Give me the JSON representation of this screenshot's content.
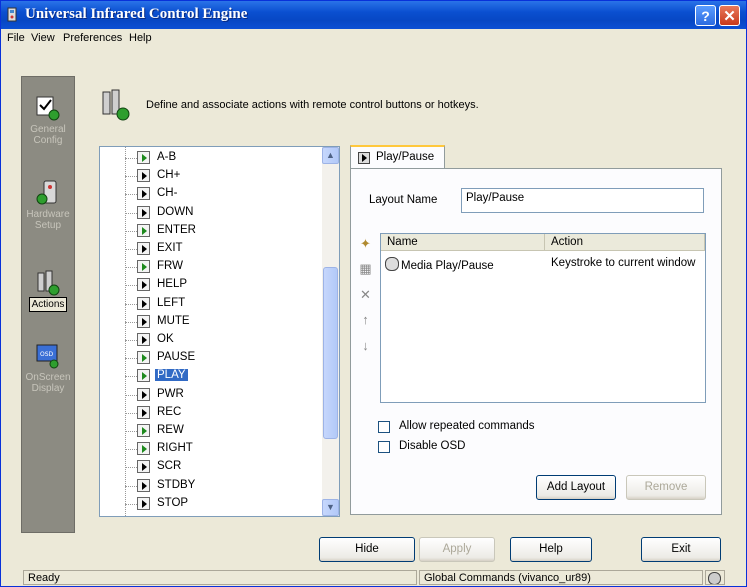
{
  "window": {
    "title": "Universal Infrared Control Engine",
    "help_glyph": "?",
    "close_glyph": "✕"
  },
  "menu": [
    "File",
    "View",
    "Preferences",
    "Help"
  ],
  "sidebar": {
    "items": [
      {
        "label": "General\nConfig",
        "icon": "general-config-icon",
        "active": false
      },
      {
        "label": "Hardware\nSetup",
        "icon": "hardware-setup-icon",
        "active": false
      },
      {
        "label": "Actions",
        "icon": "actions-icon",
        "active": true
      },
      {
        "label": "OnScreen\nDisplay",
        "icon": "onscreen-display-icon",
        "active": false
      }
    ]
  },
  "header": {
    "description": "Define and associate actions with remote control buttons or hotkeys."
  },
  "tree": {
    "selected": "PLAY",
    "items": [
      {
        "label": "A-B",
        "green": true
      },
      {
        "label": "CH+",
        "green": false
      },
      {
        "label": "CH-",
        "green": false
      },
      {
        "label": "DOWN",
        "green": false
      },
      {
        "label": "ENTER",
        "green": true
      },
      {
        "label": "EXIT",
        "green": false
      },
      {
        "label": "FRW",
        "green": true
      },
      {
        "label": "HELP",
        "green": false
      },
      {
        "label": "LEFT",
        "green": false
      },
      {
        "label": "MUTE",
        "green": false
      },
      {
        "label": "OK",
        "green": false
      },
      {
        "label": "PAUSE",
        "green": true
      },
      {
        "label": "PLAY",
        "green": true
      },
      {
        "label": "PWR",
        "green": false
      },
      {
        "label": "REC",
        "green": false
      },
      {
        "label": "REW",
        "green": true
      },
      {
        "label": "RIGHT",
        "green": true
      },
      {
        "label": "SCR",
        "green": false
      },
      {
        "label": "STDBY",
        "green": false
      },
      {
        "label": "STOP",
        "green": false
      }
    ]
  },
  "panel": {
    "tab_label": "Play/Pause",
    "layout_name_label": "Layout Name",
    "layout_name_value": "Play/Pause",
    "columns": [
      "Name",
      "Action"
    ],
    "rows": [
      {
        "name": "Media Play/Pause",
        "action": "Keystroke to current window"
      }
    ],
    "allow_repeated_label": "Allow repeated commands",
    "disable_osd_label": "Disable OSD",
    "add_layout_label": "Add Layout",
    "remove_label": "Remove"
  },
  "buttons": {
    "hide": "Hide",
    "apply": "Apply",
    "help": "Help",
    "exit": "Exit"
  },
  "status": {
    "left": "Ready",
    "right": "Global Commands (vivanco_ur89)"
  }
}
